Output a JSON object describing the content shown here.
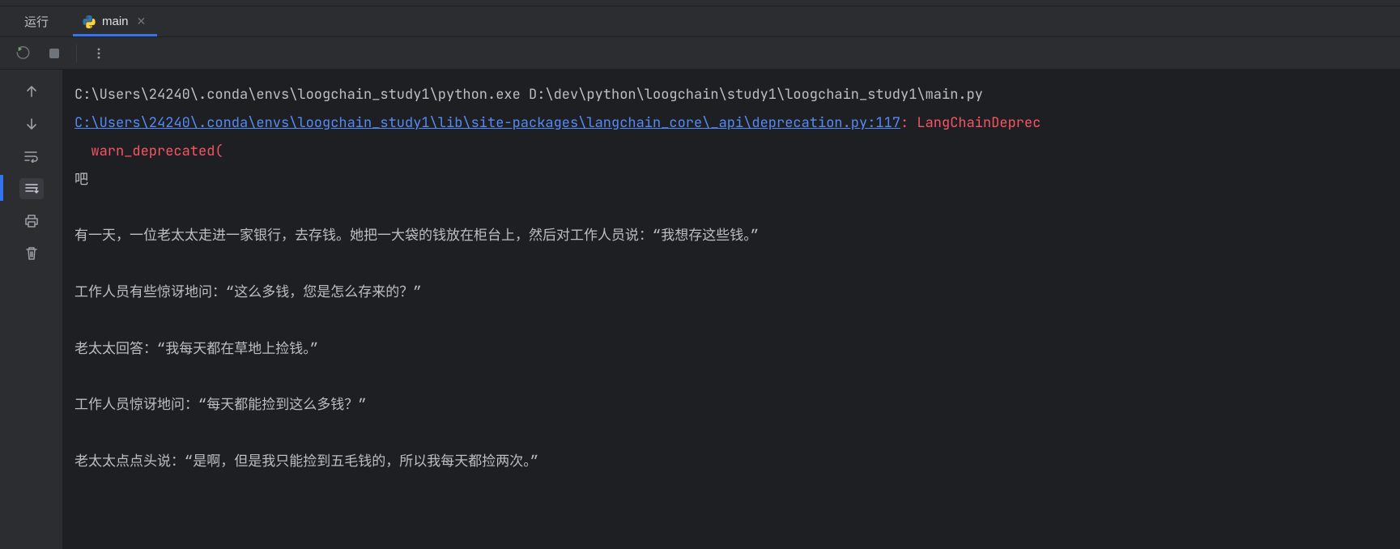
{
  "tabbar": {
    "label": "运行",
    "tab_name": "main"
  },
  "console": {
    "command": "C:\\Users\\24240\\.conda\\envs\\loogchain_study1\\python.exe D:\\dev\\python\\loogchain\\study1\\loogchain_study1\\main.py",
    "link": "C:\\Users\\24240\\.conda\\envs\\loogchain_study1\\lib\\site-packages\\langchain_core\\_api\\deprecation.py:117",
    "err_head": ": LangChainDeprec",
    "err_indent": "  warn_deprecated(",
    "lines": [
      "吧",
      "",
      "有一天，一位老太太走进一家银行，去存钱。她把一大袋的钱放在柜台上，然后对工作人员说：“我想存这些钱。”",
      "",
      "工作人员有些惊讶地问：“这么多钱，您是怎么存来的？”",
      "",
      "老太太回答：“我每天都在草地上捡钱。”",
      "",
      "工作人员惊讶地问：“每天都能捡到这么多钱？”",
      "",
      "老太太点点头说：“是啊，但是我只能捡到五毛钱的，所以我每天都捡两次。”"
    ]
  }
}
